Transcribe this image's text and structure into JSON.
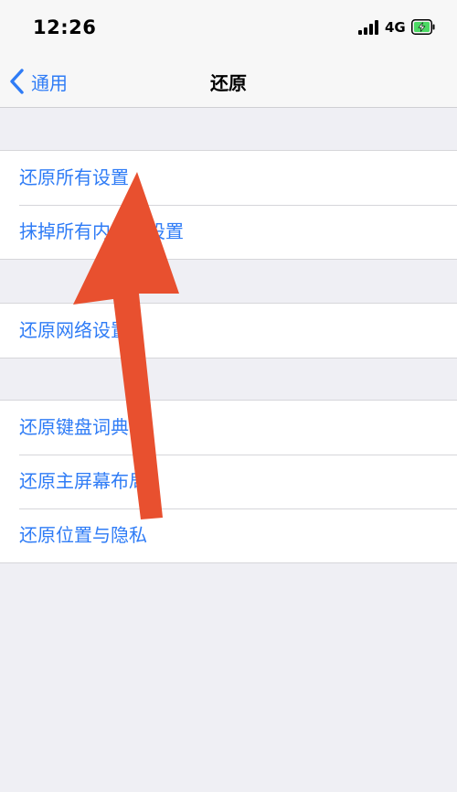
{
  "status_bar": {
    "time": "12:26",
    "network": "4G",
    "icons": [
      "signal-icon",
      "battery-charging-icon"
    ]
  },
  "nav": {
    "back_label": "通用",
    "title": "还原"
  },
  "groups": [
    {
      "items": [
        {
          "label": "还原所有设置"
        },
        {
          "label": "抹掉所有内容和设置"
        }
      ]
    },
    {
      "items": [
        {
          "label": "还原网络设置"
        }
      ]
    },
    {
      "items": [
        {
          "label": "还原键盘词典"
        },
        {
          "label": "还原主屏幕布局"
        },
        {
          "label": "还原位置与隐私"
        }
      ]
    }
  ],
  "colors": {
    "accent": "#2f7cf6",
    "background": "#efeff4",
    "annotation_arrow": "#e8502f",
    "battery_charge": "#4cd964"
  }
}
